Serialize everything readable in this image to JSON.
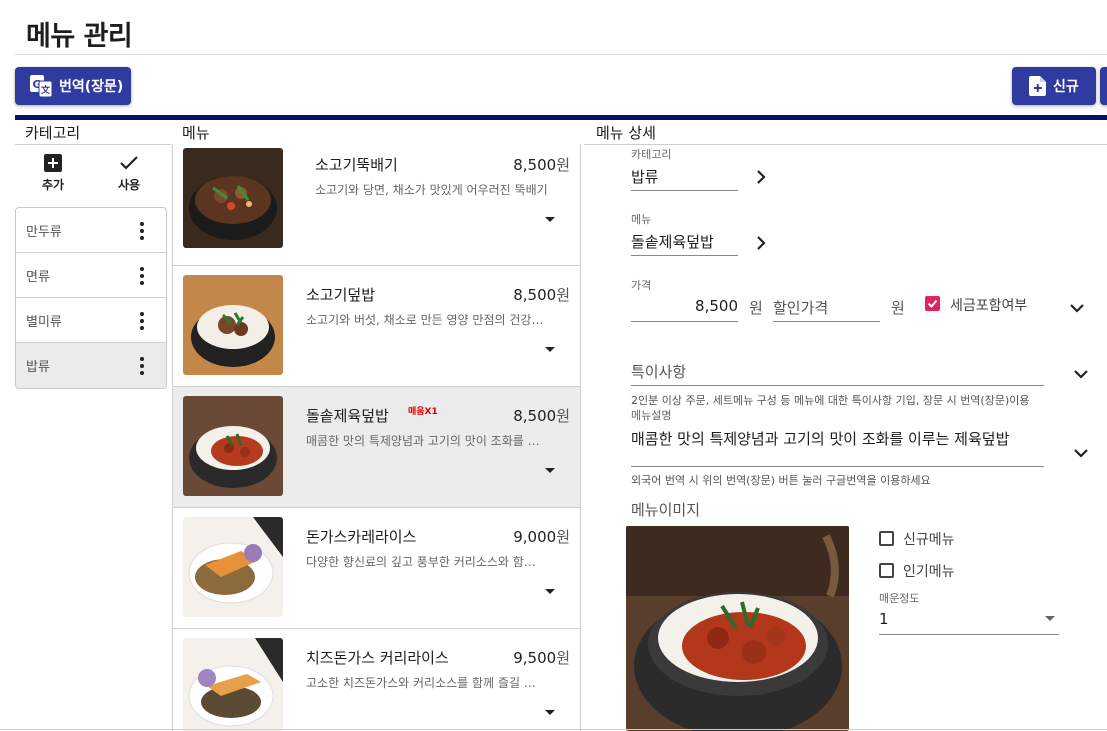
{
  "page": {
    "title": "메뉴 관리"
  },
  "toolbar": {
    "translate_label": "번역(장문)",
    "new_label": "신규"
  },
  "columns": {
    "category": "카테고리",
    "menu": "메뉴",
    "detail": "메뉴 상세"
  },
  "category_tools": {
    "add_label": "추가",
    "use_label": "사용"
  },
  "categories": [
    {
      "label": "만두류"
    },
    {
      "label": "면류"
    },
    {
      "label": "별미류"
    },
    {
      "label": "밥류",
      "selected": true
    }
  ],
  "menu_items": [
    {
      "name": "소고기뚝배기",
      "price": "8,500",
      "won": "원",
      "desc": "소고기와 당면, 채소가 맛있게 어우러진 뚝배기",
      "badge": ""
    },
    {
      "name": "소고기덮밥",
      "price": "8,500",
      "won": "원",
      "desc": "소고기와 버섯, 채소로 만든 영양 만점의 건강 덮밥",
      "badge": ""
    },
    {
      "name": "돌솥제육덮밥",
      "price": "8,500",
      "won": "원",
      "desc": "매콤한 맛의 특제양념과 고기의 맛이 조화를 이루는 제육덮밥",
      "badge": "매움X1",
      "selected": true
    },
    {
      "name": "돈가스카레라이스",
      "price": "9,000",
      "won": "원",
      "desc": "다양한 향신료의 깊고 풍부한 커리소스와 함께 즐기는 돈가스",
      "badge": ""
    },
    {
      "name": "치즈돈가스 커리라이스",
      "price": "9,500",
      "won": "원",
      "desc": "고소한 치즈돈가스와 커리소스를 함께 즐길 수 있는 메뉴",
      "badge": ""
    }
  ],
  "detail": {
    "category_label": "카테고리",
    "category_value": "밥류",
    "menu_label": "메뉴",
    "menu_value": "돌솥제육덮밥",
    "price_label": "가격",
    "price_value": "8,500",
    "price_unit": "원",
    "discount_placeholder": "할인가격",
    "discount_unit": "원",
    "tax_label": "세금포함여부",
    "tax_checked": true,
    "special_placeholder": "특이사항",
    "special_hint": "2인분 이상 주문, 세트메뉴 구성 등 메뉴에 대한 특이사항 기입, 장문 시 번역(장문)이용",
    "desc_label": "메뉴설명",
    "desc_value": "매콤한 맛의 특제양념과 고기의 맛이 조화를 이루는 제육덮밥",
    "desc_hint": "외국어 번역 시 위의 번역(장문) 버튼 눌러 구글번역을 이용하세요",
    "image_label": "메뉴이미지",
    "new_menu_label": "신규메뉴",
    "popular_menu_label": "인기메뉴",
    "spicy_label": "매운정도",
    "spicy_value": "1"
  },
  "colors": {
    "primary": "#2f3b9e",
    "header_bar": "#0a0f6e",
    "badge": "#e00000",
    "checkbox_checked": "#e0245e"
  }
}
